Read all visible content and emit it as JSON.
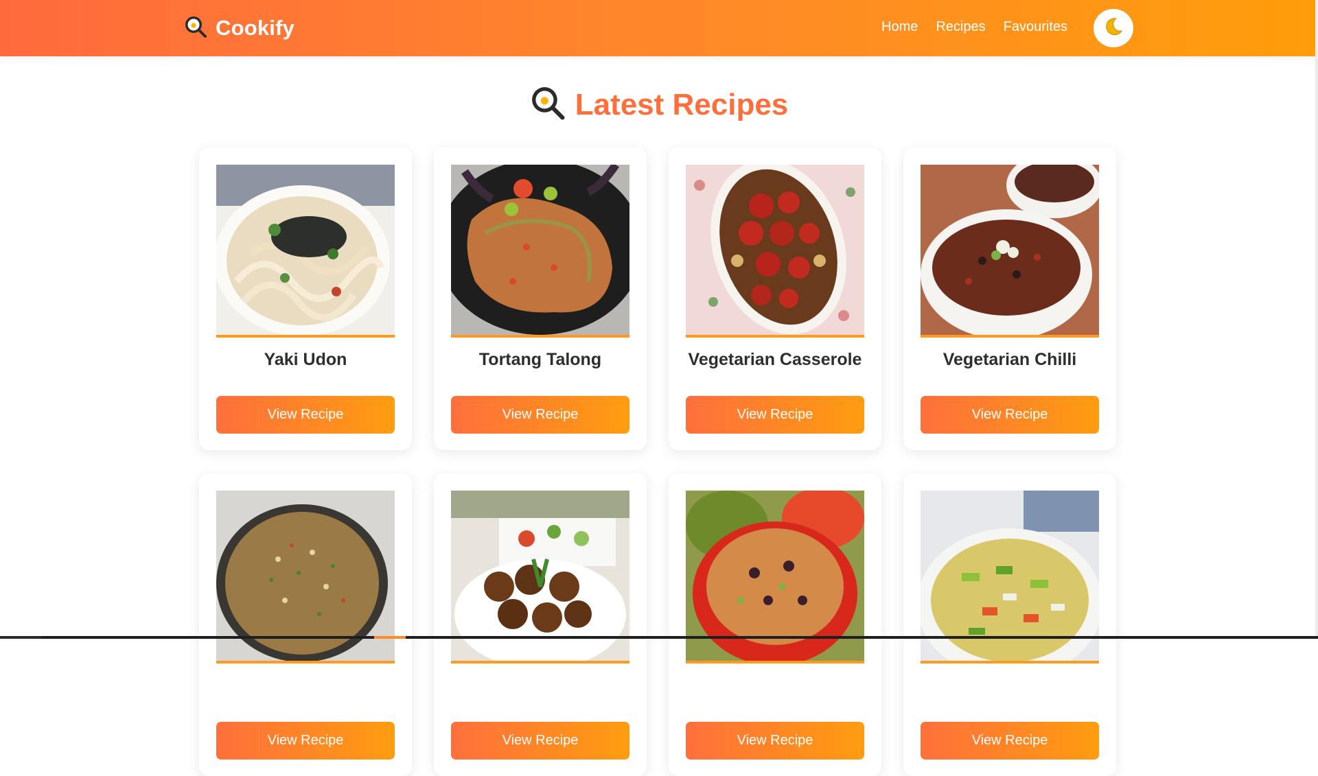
{
  "brand": {
    "name": "Cookify",
    "icon": "frying-pan-egg-icon"
  },
  "nav": {
    "links": [
      "Home",
      "Recipes",
      "Favourites"
    ],
    "theme_icon": "crescent-moon-icon"
  },
  "page": {
    "heading": "Latest Recipes",
    "heading_icon": "frying-pan-egg-icon"
  },
  "recipes": [
    {
      "title": "Yaki Udon",
      "button": "View Recipe",
      "image": "yaki-udon-photo"
    },
    {
      "title": "Tortang Talong",
      "button": "View Recipe",
      "image": "tortang-talong-photo"
    },
    {
      "title": "Vegetarian Casserole",
      "button": "View Recipe",
      "image": "vegetarian-casserole-photo"
    },
    {
      "title": "Vegetarian Chilli",
      "button": "View Recipe",
      "image": "vegetarian-chilli-photo"
    },
    {
      "title": "",
      "button": "View Recipe",
      "image": "lentil-dish-photo"
    },
    {
      "title": "",
      "button": "View Recipe",
      "image": "falafel-photo"
    },
    {
      "title": "",
      "button": "View Recipe",
      "image": "stuffed-peppers-photo"
    },
    {
      "title": "",
      "button": "View Recipe",
      "image": "vegetable-soup-photo"
    }
  ],
  "colors": {
    "primary": "#ff6f3c",
    "accent": "#ff9d10",
    "text": "#2e2e2e"
  }
}
